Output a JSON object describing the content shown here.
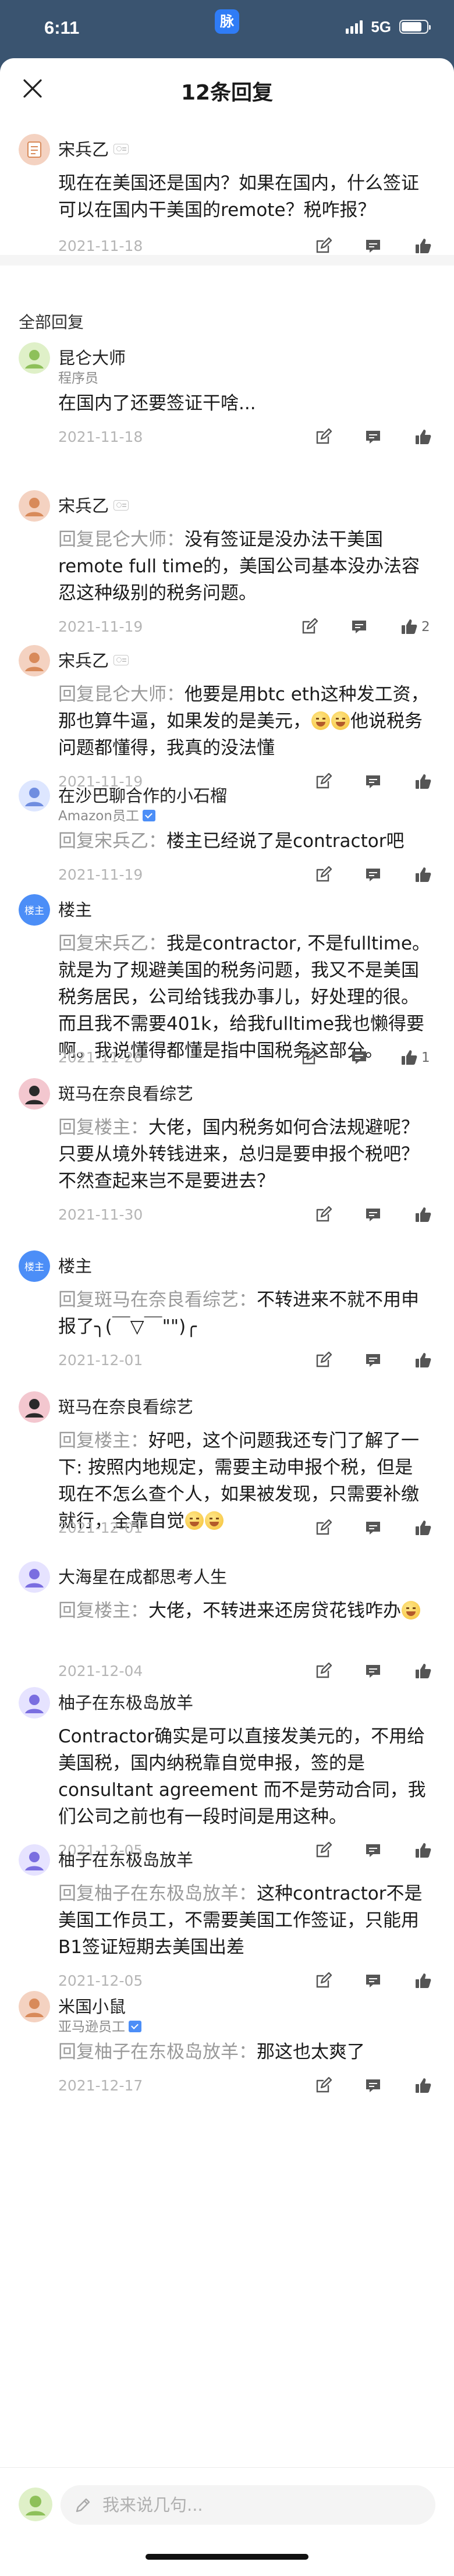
{
  "status_bar": {
    "time": "6:11",
    "app_badge": "脉",
    "network": "5G",
    "battery_level": 0.8
  },
  "sheet": {
    "title": "12条回复"
  },
  "original_comment": {
    "author": "宋兵乙",
    "text": "现在在美国还是国内？如果在国内，什么签证可以在国内干美国的remote？税咋报？",
    "date": "2021-11-18"
  },
  "section_title": "全部回复",
  "replies": [
    {
      "author": "昆仑大师",
      "subtitle": "程序员",
      "reply_to": "",
      "text": "在国内了还要签证干啥...",
      "date": "2021-11-18",
      "likes": ""
    },
    {
      "author": "宋兵乙",
      "subtitle": "",
      "reply_to": "回复昆仑大师：",
      "text": "没有签证是没办法干美国remote full time的，美国公司基本没办法容忍这种级别的税务问题。",
      "date": "2021-11-19",
      "likes": "2"
    },
    {
      "author": "宋兵乙",
      "subtitle": "",
      "reply_to": "回复昆仑大师：",
      "text": "他要是用btc eth这种发工资，那也算牛逼，如果发的是美元，",
      "text_after_emoji": "他说税务问题都懂得，我真的没法懂",
      "date": "2021-11-19",
      "likes": ""
    },
    {
      "author": "在沙巴聊合作的小石榴",
      "subtitle": "Amazon员工",
      "reply_to": "回复宋兵乙：",
      "text": "楼主已经说了是contractor吧",
      "date": "2021-11-19",
      "likes": ""
    },
    {
      "author": "楼主",
      "subtitle": "",
      "reply_to": "回复宋兵乙：",
      "text": "我是contractor, 不是fulltime。就是为了规避美国的税务问题，我又不是美国税务居民，公司给钱我办事儿，好处理的很。而且我不需要401k，给我fulltime我也懒得要啊。我说懂得都懂是指中国税务这部分。",
      "date": "2021-11-28",
      "likes": "1"
    },
    {
      "author": "斑马在奈良看综艺",
      "subtitle": "",
      "reply_to": "回复楼主：",
      "text": "大佬，国内税务如何合法规避呢？只要从境外转钱进来，总归是要申报个税吧？不然查起来岂不是要进去？",
      "date": "2021-11-30",
      "likes": ""
    },
    {
      "author": "楼主",
      "subtitle": "",
      "reply_to": "回复斑马在奈良看综艺：",
      "text": "不转进来不就不用申报了╮(￣▽￣\"\")╭",
      "date": "2021-12-01",
      "likes": ""
    },
    {
      "author": "斑马在奈良看综艺",
      "subtitle": "",
      "reply_to": "回复楼主：",
      "text": "好吧，这个问题我还专门了解了一下: 按照内地规定，需要主动申报个税，但是现在不怎么查个人，如果被发现，只需要补缴就行，全靠自觉",
      "date": "2021-12-01",
      "likes": ""
    },
    {
      "author": "大海星在成都思考人生",
      "subtitle": "",
      "reply_to": "回复楼主：",
      "text": "大佬，不转进来还房贷花钱咋办",
      "date": "2021-12-04",
      "likes": ""
    },
    {
      "author": "柚子在东极岛放羊",
      "subtitle": "",
      "reply_to": "",
      "text": "Contractor确实是可以直接发美元的，不用给美国税，国内纳税靠自觉申报，签的是consultant agreement 而不是劳动合同，我们公司之前也有一段时间是用这种。",
      "date": "2021-12-05",
      "likes": ""
    },
    {
      "author": "柚子在东极岛放羊",
      "subtitle": "",
      "reply_to": "回复柚子在东极岛放羊：",
      "text": "这种contractor不是美国工作员工，不需要美国工作签证，只能用B1签证短期去美国出差",
      "date": "2021-12-05",
      "likes": ""
    },
    {
      "author": "米国小鼠",
      "subtitle": "亚马逊员工",
      "reply_to": "回复柚子在东极岛放羊：",
      "text": "那这也太爽了",
      "date": "2021-12-17",
      "likes": ""
    }
  ],
  "reply_box": {
    "placeholder": "我来说几句..."
  },
  "colors": {
    "accent": "#4c8ef7",
    "overlay": "#3a5470",
    "meta_gray": "#b5b5b5"
  },
  "icons": [
    "close-icon",
    "edit-icon",
    "comment-icon",
    "thumbs-up-icon",
    "pencil-icon",
    "verified-icon",
    "emoji-icon"
  ]
}
